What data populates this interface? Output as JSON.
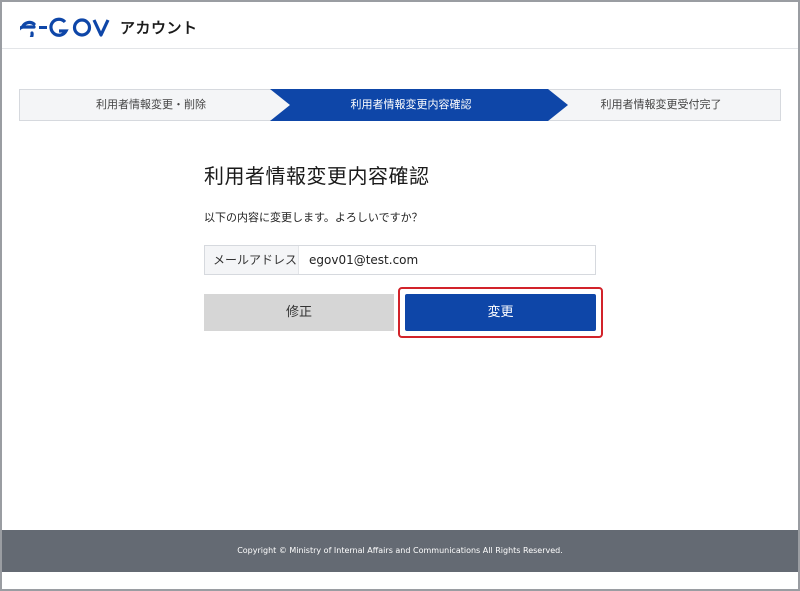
{
  "header": {
    "logo_text": "アカウント"
  },
  "steps": [
    {
      "label": "利用者情報変更・削除",
      "active": false
    },
    {
      "label": "利用者情報変更内容確認",
      "active": true
    },
    {
      "label": "利用者情報変更受付完了",
      "active": false
    }
  ],
  "page": {
    "title": "利用者情報変更内容確認",
    "prompt": "以下の内容に変更します。よろしいですか？"
  },
  "field": {
    "label": "メールアドレス",
    "value": "egov01@test.com"
  },
  "buttons": {
    "fix_label": "修正",
    "change_label": "変更"
  },
  "footer": {
    "copyright": "Copyright © Ministry of Internal Affairs and Communications All Rights Reserved."
  },
  "colors": {
    "brand_blue": "#0e46a8",
    "highlight_red": "#d2232a",
    "footer_gray": "#646a73"
  }
}
